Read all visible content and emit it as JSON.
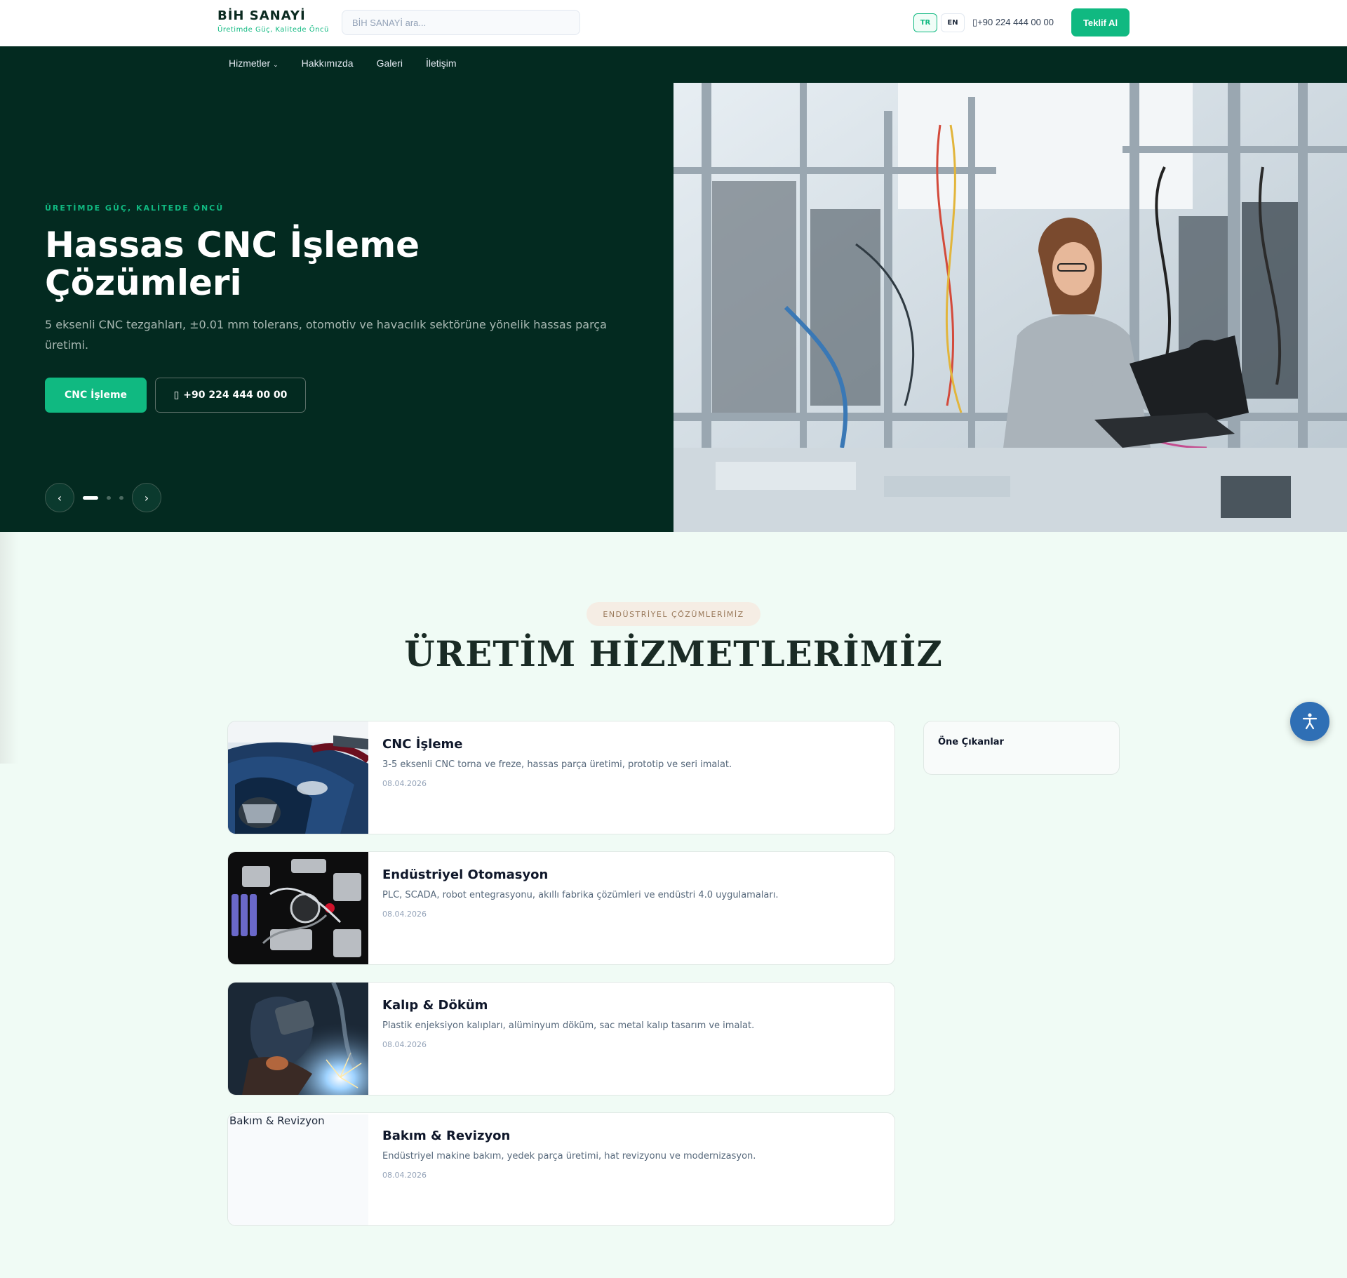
{
  "header": {
    "brand_name": "BİH SANAYİ",
    "brand_tagline": "Üretimde Güç, Kalitede Öncü",
    "search_placeholder": "BİH SANAYİ ara...",
    "lang_tr": "TR",
    "lang_en": "EN",
    "phone": "+90 224 444 00 00",
    "quote_button": "Teklif Al"
  },
  "nav": {
    "items": [
      "Hizmetler",
      "Hakkımızda",
      "Galeri",
      "İletişim"
    ]
  },
  "hero": {
    "kicker": "ÜRETİMDE GÜÇ, KALİTEDE ÖNCÜ",
    "title": "Hassas CNC İşleme Çözümleri",
    "description": "5 eksenli CNC tezgahları, ±0.01 mm tolerans, otomotiv ve havacılık sektörüne yönelik hassas parça üretimi.",
    "primary_cta": "CNC İşleme",
    "phone_cta": "+90 224 444 00 00",
    "prev_label": "‹",
    "next_label": "›"
  },
  "section": {
    "badge": "ENDÜSTRİYEL ÇÖZÜMLERİMİZ",
    "title": "ÜRETİM HİZMETLERİMİZ"
  },
  "services": [
    {
      "title": "CNC İşleme",
      "description": "3-5 eksenli CNC torna ve freze, hassas parça üretimi, prototip ve seri imalat.",
      "date": "08.04.2026"
    },
    {
      "title": "Endüstriyel Otomasyon",
      "description": "PLC, SCADA, robot entegrasyonu, akıllı fabrika çözümleri ve endüstri 4.0 uygulamaları.",
      "date": "08.04.2026"
    },
    {
      "title": "Kalıp & Döküm",
      "description": "Plastik enjeksiyon kalıpları, alüminyum döküm, sac metal kalıp tasarım ve imalat.",
      "date": "08.04.2026"
    },
    {
      "title": "Bakım & Revizyon",
      "description": "Endüstriyel makine bakım, yedek parça üretimi, hat revizyonu ve modernizasyon.",
      "date": "08.04.2026",
      "image_alt": "Bakım & Revizyon"
    }
  ],
  "sidebar": {
    "featured_title": "Öne Çıkanlar"
  },
  "icons": {
    "phone": "phone-icon",
    "accessibility": "accessibility-icon",
    "chevron": "chevron-down-icon"
  },
  "colors": {
    "accent": "#10b981",
    "hero_bg": "#032a20",
    "page_bg": "#f0fbf5",
    "a11y_button": "#2f6fb5"
  }
}
